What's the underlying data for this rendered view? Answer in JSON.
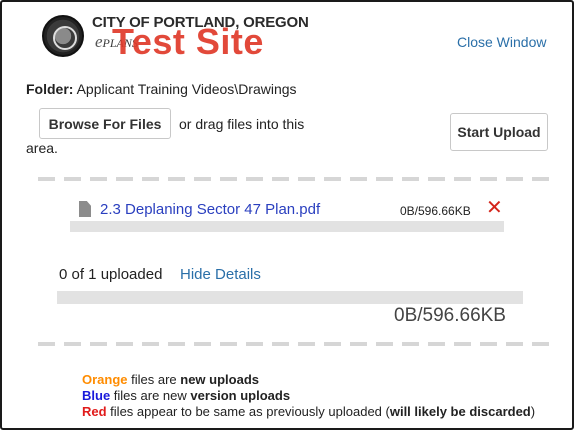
{
  "header": {
    "city_name": "CITY OF PORTLAND, OREGON",
    "eplans_e": "e",
    "eplans_rest": "PLANS",
    "test_site": "Test Site",
    "close_window": "Close Window"
  },
  "folder": {
    "label": "Folder:",
    "path": "Applicant Training Videos\\Drawings"
  },
  "upload": {
    "browse_label": "Browse For Files",
    "drag_text_1": "or drag files into this",
    "drag_text_2": "area.",
    "start_label": "Start Upload"
  },
  "files": [
    {
      "name": "2.3 Deplaning Sector 47 Plan.pdf",
      "progress": "0B/596.66KB",
      "progress_fraction": 0
    }
  ],
  "summary": {
    "count_text": "0 of 1 uploaded",
    "hide_details": "Hide Details",
    "total_size": "0B/596.66KB",
    "progress_fraction": 0
  },
  "legend": {
    "orange_word": "Orange",
    "orange_mid": " files are ",
    "orange_bold": "new uploads",
    "blue_word": "Blue",
    "blue_mid": " files are new ",
    "blue_bold": "version uploads",
    "red_word": "Red",
    "red_mid": " files appear to be same as previously uploaded (",
    "red_bold": "will likely be discarded",
    "red_end": ")"
  },
  "colors": {
    "accent_link": "#2a6fa8",
    "file_link": "#2a3fbf",
    "test_site": "#e03a2a",
    "remove": "#d4241a",
    "orange": "#ff8c00",
    "blue": "#1a1adb",
    "red": "#e11b1b"
  },
  "icons": {
    "seal": "city-seal-icon",
    "file": "file-icon",
    "remove": "close-x-icon"
  }
}
